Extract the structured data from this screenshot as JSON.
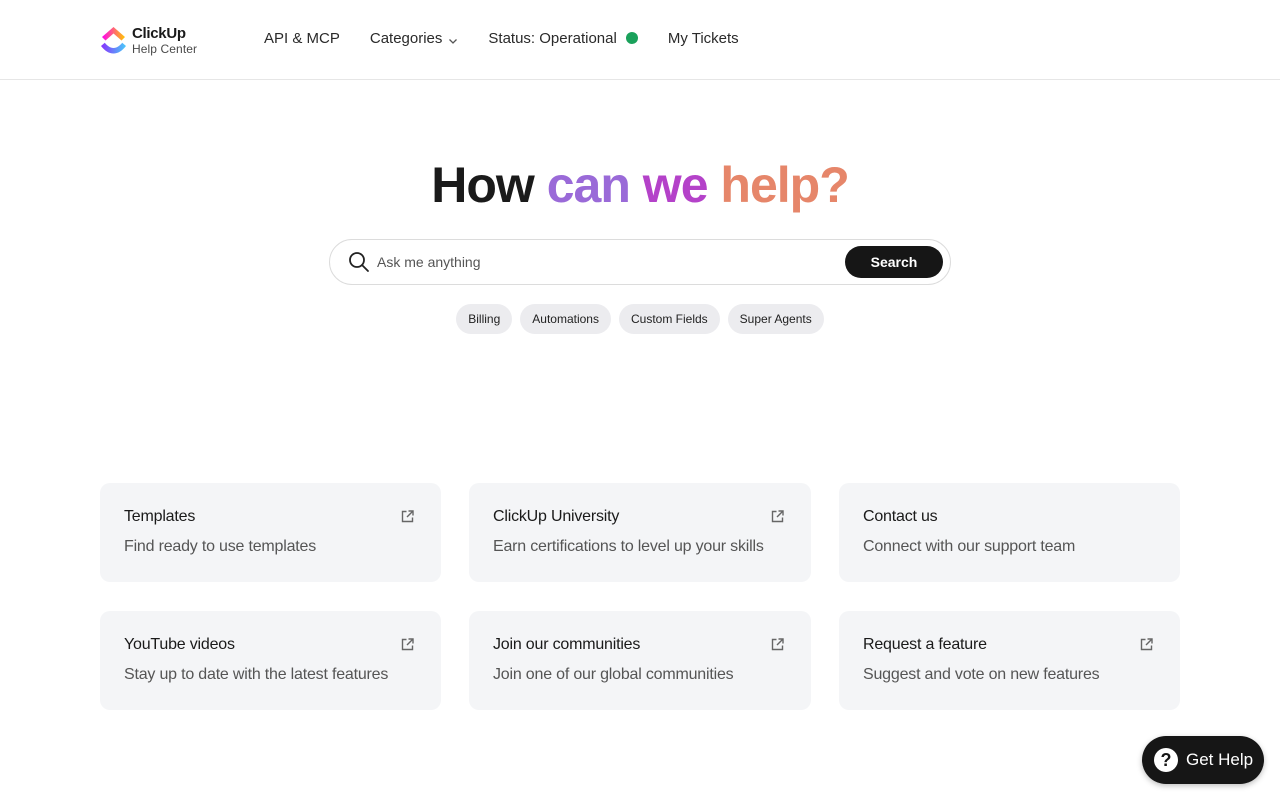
{
  "brand": {
    "title": "ClickUp",
    "subtitle": "Help Center",
    "colors": {
      "pink": "#fc2b7c",
      "orange": "#ffb020",
      "purple": "#7b5cff",
      "blue": "#1ea0ff"
    }
  },
  "nav": {
    "api_label": "API & MCP",
    "categories_label": "Categories",
    "status_label": "Status: Operational",
    "status_color": "#1aa15b",
    "tickets_label": "My Tickets"
  },
  "hero": {
    "title_words": [
      {
        "text": "How",
        "color": "#1a1a1a"
      },
      {
        "text": "can",
        "color": "#9a6ad8"
      },
      {
        "text": "we",
        "color": "#b442c9"
      },
      {
        "text": "help?",
        "color": "#e6866a"
      }
    ]
  },
  "search": {
    "placeholder": "Ask me anything",
    "button_label": "Search",
    "icon": "search-icon"
  },
  "chips": [
    "Billing",
    "Automations",
    "Custom Fields",
    "Super Agents"
  ],
  "cards": [
    {
      "title": "Templates",
      "description": "Find ready to use templates",
      "icon": "external-link-icon"
    },
    {
      "title": "ClickUp University",
      "description": "Earn certifications to level up your skills",
      "icon": "external-link-icon"
    },
    {
      "title": "Contact us",
      "description": "Connect with our support team",
      "icon": ""
    },
    {
      "title": "YouTube videos",
      "description": "Stay up to date with the latest features",
      "icon": "external-link-icon"
    },
    {
      "title": "Join our communities",
      "description": "Join one of our global communities",
      "icon": "external-link-icon"
    },
    {
      "title": "Request a feature",
      "description": "Suggest and vote on new features",
      "icon": "external-link-icon"
    }
  ],
  "get_help": {
    "label": "Get Help",
    "icon": "question-icon"
  }
}
